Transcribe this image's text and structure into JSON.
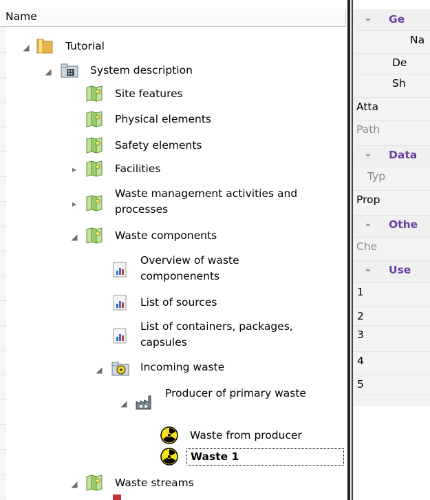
{
  "tree": {
    "column_header": "Name",
    "nodes": [
      {
        "label": "Tutorial",
        "expander": "expanded",
        "icon": "folder-icon"
      },
      {
        "label": "System description",
        "expander": "expanded",
        "icon": "building-folder-icon"
      },
      {
        "label": "Site features",
        "expander": "none",
        "icon": "map-icon"
      },
      {
        "label": "Physical elements",
        "expander": "none",
        "icon": "map-icon"
      },
      {
        "label": "Safety elements",
        "expander": "none",
        "icon": "map-icon"
      },
      {
        "label": "Facilities",
        "expander": "collapsed",
        "icon": "map-icon"
      },
      {
        "label": "Waste management activities and processes",
        "expander": "collapsed",
        "icon": "map-icon"
      },
      {
        "label": "Waste components",
        "expander": "expanded",
        "icon": "map-icon"
      },
      {
        "label": "Overview of waste componenents",
        "expander": "none",
        "icon": "chart-page-icon"
      },
      {
        "label": "List of sources",
        "expander": "none",
        "icon": "chart-page-icon"
      },
      {
        "label": "List of containers, packages, capsules",
        "expander": "none",
        "icon": "chart-page-icon"
      },
      {
        "label": "Incoming waste",
        "expander": "expanded",
        "icon": "radiation-folder-icon"
      },
      {
        "label": "Producer of primary waste",
        "expander": "expanded",
        "icon": "factory-icon"
      },
      {
        "label": "Waste from producer",
        "expander": "none",
        "icon": "radiation-icon"
      },
      {
        "label": "Waste 1",
        "expander": "none",
        "icon": "radiation-icon",
        "selected": true
      },
      {
        "label": "Waste streams",
        "expander": "expanded",
        "icon": "map-icon"
      }
    ]
  },
  "properties": {
    "rows": [
      {
        "kind": "category",
        "text": "Ge"
      },
      {
        "kind": "item",
        "text": "Na"
      },
      {
        "kind": "item",
        "text": "De"
      },
      {
        "kind": "item",
        "text": "Sh"
      },
      {
        "kind": "item",
        "text": "Atta"
      },
      {
        "kind": "dim",
        "text": "Path"
      },
      {
        "kind": "category",
        "text": "Data"
      },
      {
        "kind": "dim",
        "text": "Typ"
      },
      {
        "kind": "item",
        "text": "Prop"
      },
      {
        "kind": "category",
        "text": "Othe"
      },
      {
        "kind": "dim",
        "text": "Che"
      },
      {
        "kind": "category",
        "text": "Use"
      },
      {
        "kind": "item",
        "text": "1"
      },
      {
        "kind": "item",
        "text": "2"
      },
      {
        "kind": "item",
        "text": "3"
      },
      {
        "kind": "item",
        "text": "4"
      },
      {
        "kind": "item",
        "text": "5"
      }
    ]
  },
  "colors": {
    "category_text": "#6a3fa0",
    "selection_border": "#000000"
  }
}
